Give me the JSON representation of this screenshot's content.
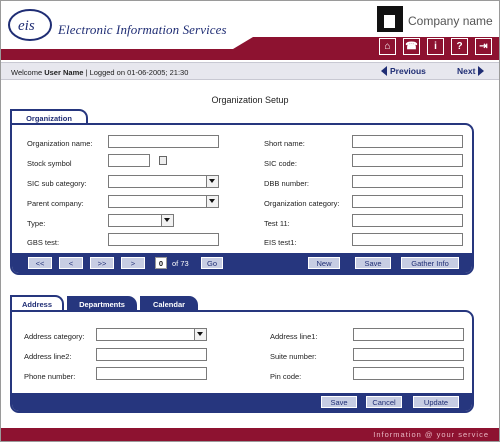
{
  "header": {
    "logo_text": "eis",
    "app_title": "Electronic Information Services",
    "company_name": "Company name",
    "icons": [
      {
        "name": "home-icon",
        "glyph": "⌂"
      },
      {
        "name": "phone-icon",
        "glyph": "☎"
      },
      {
        "name": "info-icon",
        "glyph": "i"
      },
      {
        "name": "help-icon",
        "glyph": "?"
      },
      {
        "name": "logout-icon",
        "glyph": "⇥"
      }
    ]
  },
  "welcome": {
    "prefix": "Welcome",
    "user": "User Name",
    "separator": "|",
    "logged": "Logged on 01-06-2005;  21:30",
    "previous": "Previous",
    "next": "Next"
  },
  "page_title": "Organization Setup",
  "org_tab": "Organization",
  "org_form": {
    "organization_name": {
      "label": "Organization name:",
      "value": ""
    },
    "stock_symbol": {
      "label": "Stock symbol",
      "value": ""
    },
    "sic_sub_category": {
      "label": "SIC sub category:",
      "value": ""
    },
    "parent_company": {
      "label": "Parent company:",
      "value": ""
    },
    "type": {
      "label": "Type:",
      "value": ""
    },
    "gbs_test": {
      "label": "GBS test:",
      "value": ""
    },
    "short_name": {
      "label": "Short name:",
      "value": ""
    },
    "sic_code": {
      "label": "SIC code:",
      "value": ""
    },
    "dbb_number": {
      "label": "DBB number:",
      "value": ""
    },
    "organization_category": {
      "label": "Organization category:",
      "value": ""
    },
    "test_11": {
      "label": "Test 11:",
      "value": ""
    },
    "eis_test1": {
      "label": "EIS test1:",
      "value": ""
    }
  },
  "pager": {
    "first": "<<",
    "prev": "<",
    "next_block": ">>",
    "next": ">",
    "current": "0",
    "of_text": "of 73",
    "go": "Go"
  },
  "org_actions": {
    "new": "New",
    "save": "Save",
    "gather_info": "Gather Info"
  },
  "bottom_tabs": [
    "Address",
    "Departments",
    "Calendar"
  ],
  "address_form": {
    "address_category": {
      "label": "Address category:",
      "value": ""
    },
    "address_line2": {
      "label": "Address line2:",
      "value": ""
    },
    "phone_number": {
      "label": "Phone number:",
      "value": ""
    },
    "address_line1": {
      "label": "Address line1:",
      "value": ""
    },
    "suite_number": {
      "label": "Suite number:",
      "value": ""
    },
    "pin_code": {
      "label": "Pin code:",
      "value": ""
    }
  },
  "address_actions": {
    "save": "Save",
    "cancel": "Cancel",
    "update": "Update"
  },
  "footer": {
    "text": "Information @ your service"
  },
  "colors": {
    "brand_red": "#8d1230",
    "navy": "#26367e",
    "button": "#c7cde3"
  }
}
